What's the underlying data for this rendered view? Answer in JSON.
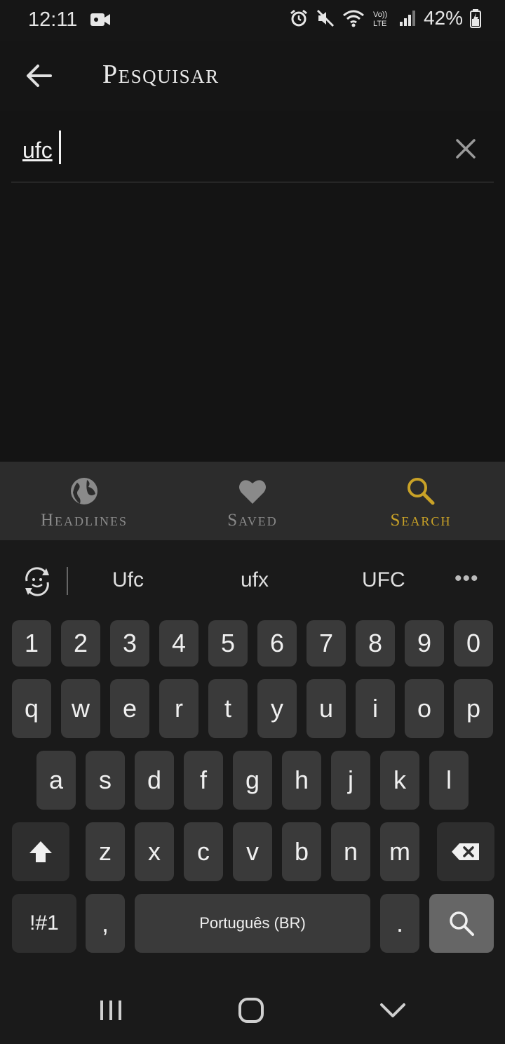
{
  "status_bar": {
    "time": "12:11",
    "battery": "42%",
    "icons": [
      "video-icon",
      "alarm-icon",
      "mute-icon",
      "wifi-icon",
      "volte-icon",
      "signal-icon",
      "battery-icon"
    ]
  },
  "header": {
    "title": "Pesquisar",
    "back_icon": "arrow-left-icon"
  },
  "search": {
    "value": "ufc",
    "clear_icon": "close-icon"
  },
  "bottom_nav": {
    "items": [
      {
        "label": "Headlines",
        "icon": "globe-icon",
        "active": false
      },
      {
        "label": "Saved",
        "icon": "heart-icon",
        "active": false
      },
      {
        "label": "Search",
        "icon": "search-icon",
        "active": true
      }
    ],
    "active_color": "#c9a227",
    "inactive_color": "#8a8a8a"
  },
  "keyboard": {
    "suggestions": [
      "Ufc",
      "ufx",
      "UFC"
    ],
    "more": "•••",
    "row_numbers": [
      "1",
      "2",
      "3",
      "4",
      "5",
      "6",
      "7",
      "8",
      "9",
      "0"
    ],
    "row_top": [
      "q",
      "w",
      "e",
      "r",
      "t",
      "y",
      "u",
      "i",
      "o",
      "p"
    ],
    "row_home": [
      "a",
      "s",
      "d",
      "f",
      "g",
      "h",
      "j",
      "k",
      "l"
    ],
    "row_bottom": [
      "z",
      "x",
      "c",
      "v",
      "b",
      "n",
      "m"
    ],
    "symbols_key": "!#1",
    "comma_key": ",",
    "space_label": "Português (BR)",
    "period_key": "."
  }
}
